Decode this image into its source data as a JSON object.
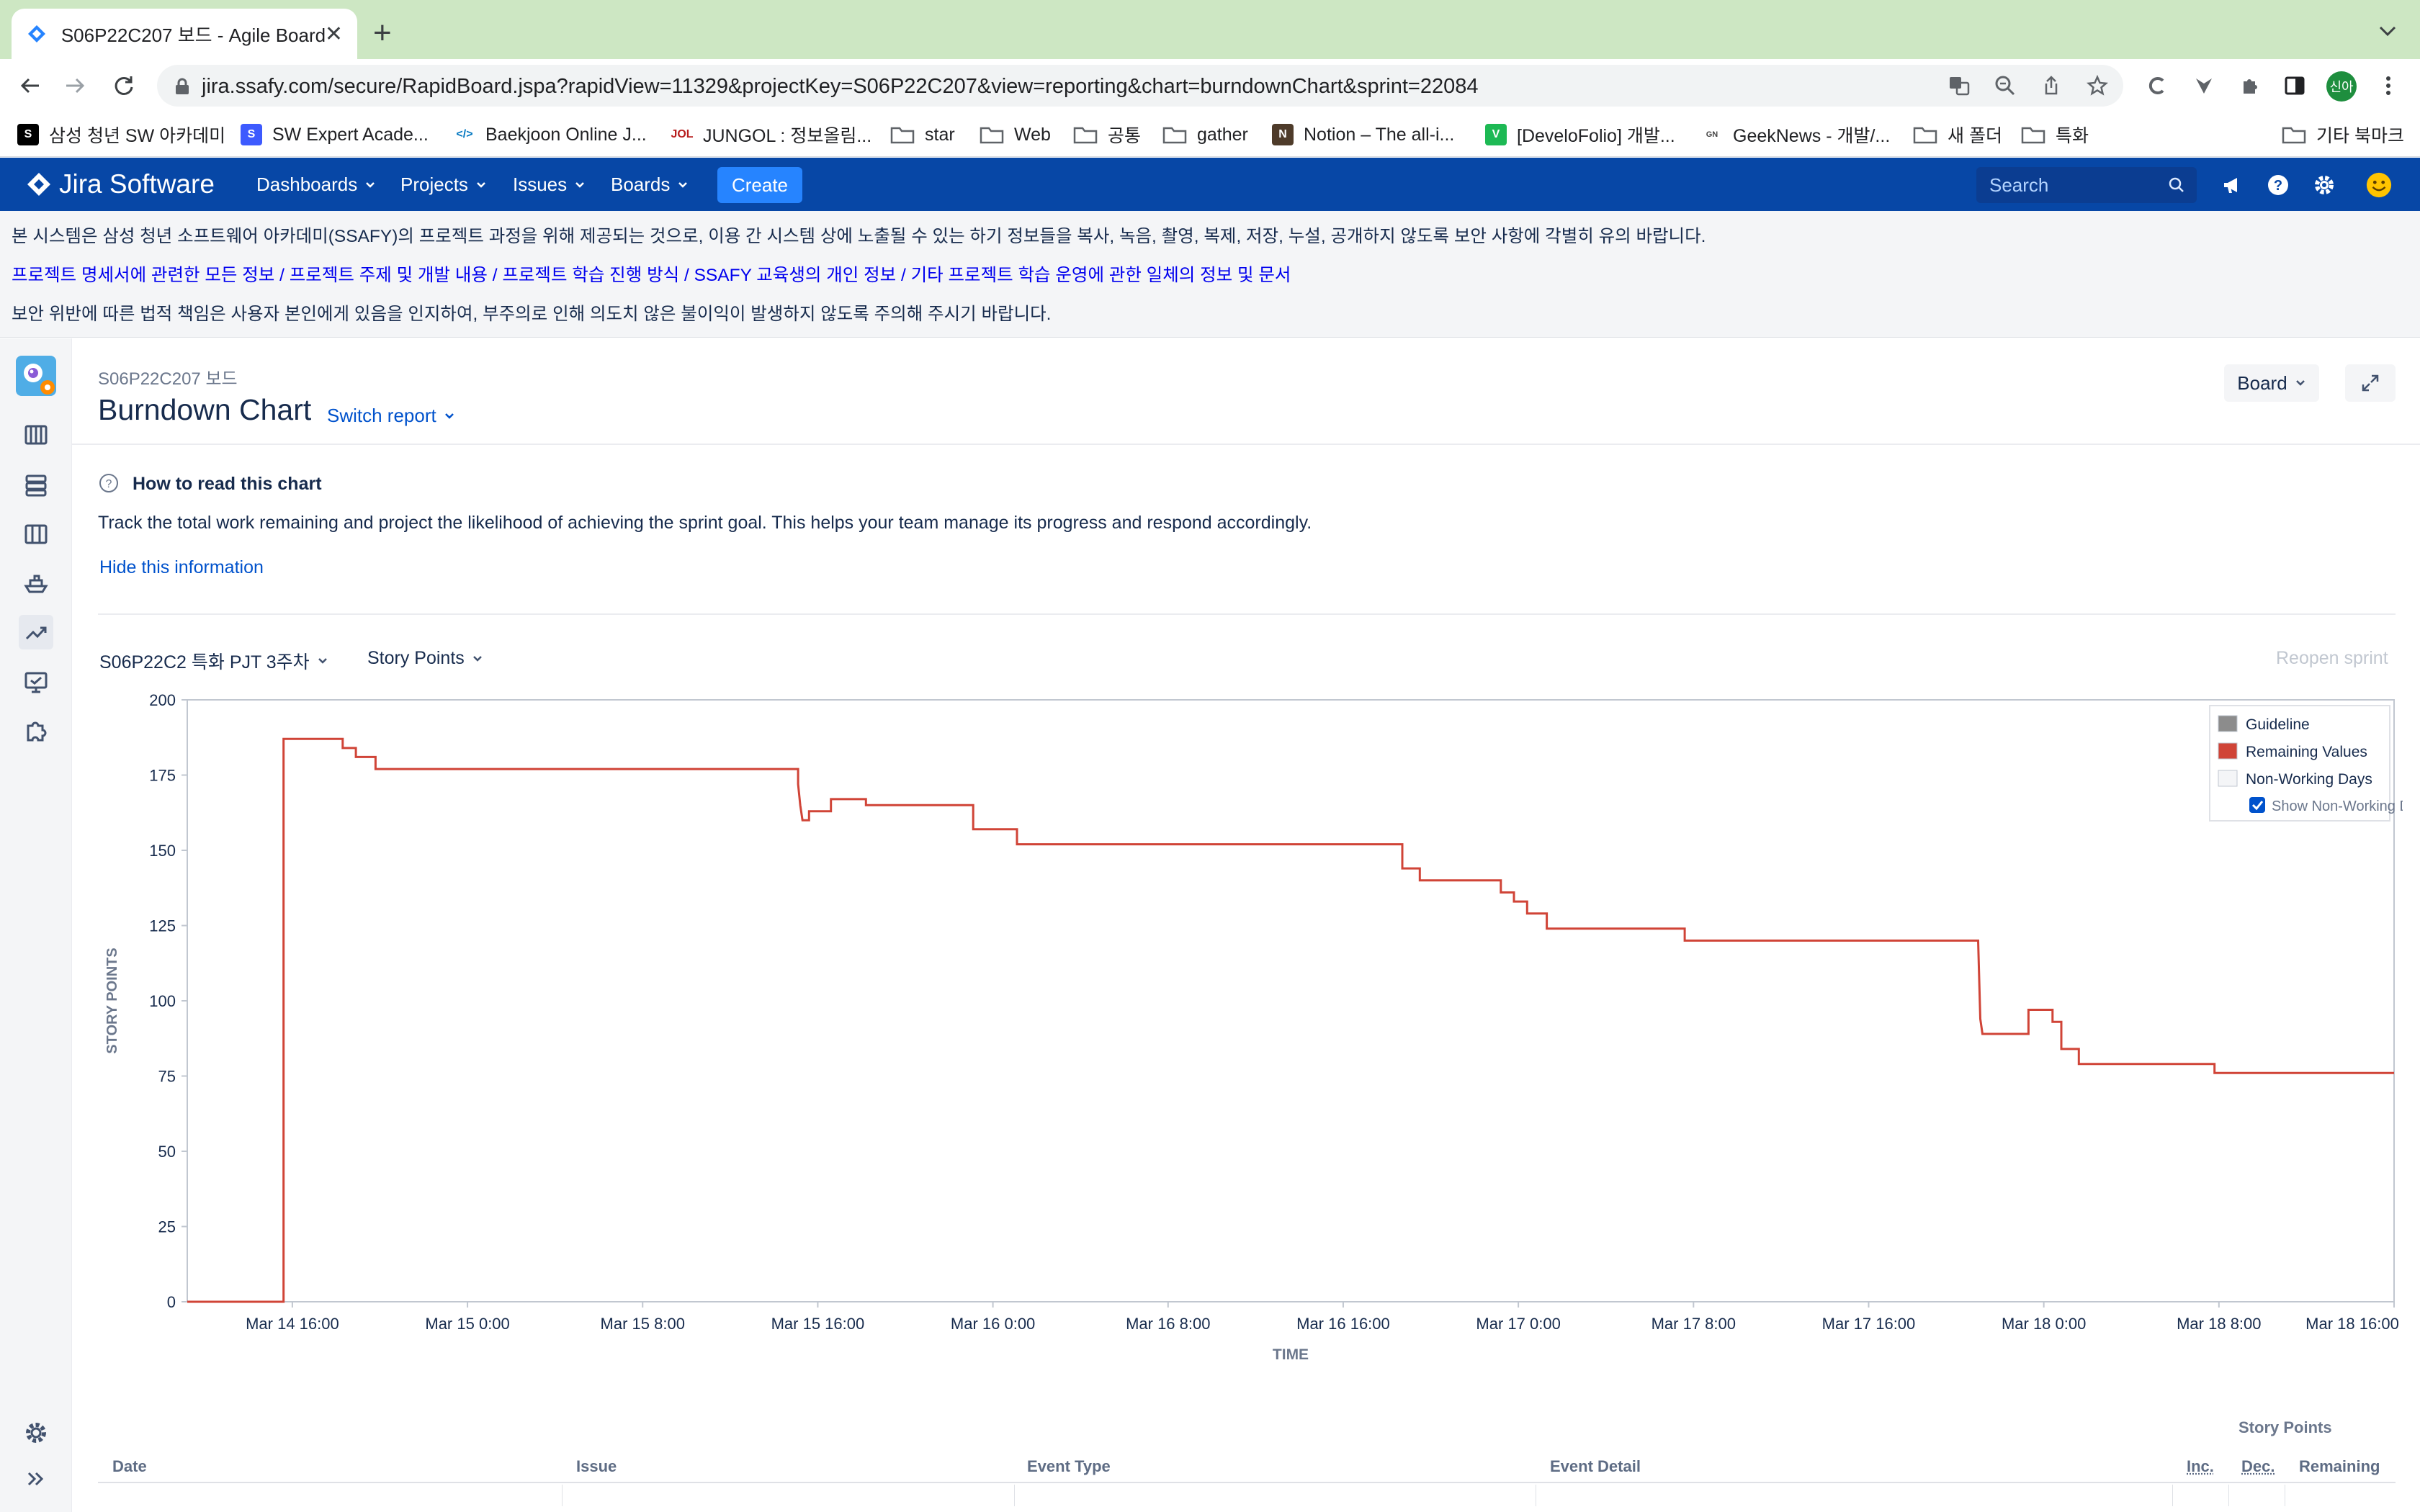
{
  "browser": {
    "tab_title": "S06P22C207 보드 - Agile Board",
    "url": "jira.ssafy.com/secure/RapidBoard.jspa?rapidView=11329&projectKey=S06P22C207&view=reporting&chart=burndownChart&sprint=22084",
    "profile_label": "신아",
    "bookmarks": [
      "삼성 청년 SW 아카데미",
      "SW Expert Acade...",
      "Baekjoon Online J...",
      "JUNGOL : 정보올림...",
      "star",
      "Web",
      "공통",
      "gather",
      "Notion – The all-i...",
      "[DeveloFolio] 개발...",
      "GeekNews - 개발/...",
      "새 폴더",
      "특화",
      "기타 북마크"
    ]
  },
  "jira_header": {
    "logo": "Jira Software",
    "nav": [
      "Dashboards",
      "Projects",
      "Issues",
      "Boards"
    ],
    "create": "Create",
    "search_placeholder": "Search"
  },
  "notice": {
    "line1": "본 시스템은 삼성 청년 소프트웨어 아카데미(SSAFY)의 프로젝트 과정을 위해 제공되는 것으로, 이용 간 시스템 상에 노출될 수 있는 하기 정보들을 복사, 녹음, 촬영, 복제, 저장, 누설, 공개하지 않도록 보안 사항에 각별히 유의 바랍니다.",
    "line2": "프로젝트 명세서에 관련한 모든 정보 / 프로젝트 주제 및 개발 내용 / 프로젝트 학습 진행 방식 / SSAFY 교육생의 개인 정보 / 기타 프로젝트 학습 운영에 관한 일체의 정보 및 문서",
    "line3": "보안 위반에 따른 법적 책임은 사용자 본인에게 있음을 인지하여, 부주의로 인해 의도치 않은 불이익이 발생하지 않도록 주의해 주시기 바랍니다."
  },
  "page": {
    "breadcrumb": "S06P22C207 보드",
    "title": "Burndown Chart",
    "switch_report": "Switch report",
    "board_button": "Board",
    "help_title": "How to read this chart",
    "help_description": "Track the total work remaining and project the likelihood of achieving the sprint goal. This helps your team manage its progress and respond accordingly.",
    "hide_info": "Hide this information",
    "sprint": "S06P22C2 특화 PJT 3주차",
    "metric": "Story Points",
    "reopen": "Reopen sprint"
  },
  "chart_data": {
    "type": "line",
    "xlabel": "TIME",
    "ylabel": "STORY POINTS",
    "ylim": [
      0,
      200
    ],
    "y_ticks": [
      0,
      25,
      50,
      75,
      100,
      125,
      150,
      175,
      200
    ],
    "x_tick_labels": [
      "Mar 14 16:00",
      "Mar 15 0:00",
      "Mar 15 8:00",
      "Mar 15 16:00",
      "Mar 16 0:00",
      "Mar 16 8:00",
      "Mar 16 16:00",
      "Mar 17 0:00",
      "Mar 17 8:00",
      "Mar 17 16:00",
      "Mar 18 0:00",
      "Mar 18 8:00",
      "Mar 18 16:00"
    ],
    "x_unit": "hours from Mar 14 0:00",
    "x_range": [
      11.2,
      112
    ],
    "x_tick_hours": [
      16,
      24,
      32,
      40,
      48,
      56,
      64,
      72,
      80,
      88,
      96,
      104,
      112
    ],
    "legend": {
      "position": "top-right",
      "items": [
        {
          "name": "Guideline",
          "color": "#8c8c8c"
        },
        {
          "name": "Remaining Values",
          "color": "#d04437"
        },
        {
          "name": "Non-Working Days",
          "color": "#f4f5f7"
        }
      ],
      "checkbox_label": "Show Non-Working Days",
      "checkbox_checked": true
    },
    "series": [
      {
        "name": "Remaining Values",
        "color": "#d04437",
        "step": true,
        "points": [
          [
            11.2,
            0
          ],
          [
            15.6,
            0
          ],
          [
            15.6,
            187
          ],
          [
            18.3,
            187
          ],
          [
            18.3,
            184
          ],
          [
            18.9,
            184
          ],
          [
            18.9,
            181
          ],
          [
            19.8,
            181
          ],
          [
            19.8,
            177
          ],
          [
            39.1,
            177
          ],
          [
            39.1,
            172
          ],
          [
            39.2,
            165
          ],
          [
            39.3,
            160
          ],
          [
            39.6,
            160
          ],
          [
            39.6,
            163
          ],
          [
            40.6,
            163
          ],
          [
            40.6,
            167
          ],
          [
            42.2,
            167
          ],
          [
            42.2,
            165
          ],
          [
            47.1,
            165
          ],
          [
            47.1,
            157
          ],
          [
            49.1,
            157
          ],
          [
            49.1,
            152
          ],
          [
            66.7,
            152
          ],
          [
            66.7,
            144
          ],
          [
            67.5,
            144
          ],
          [
            67.5,
            140
          ],
          [
            71.2,
            140
          ],
          [
            71.2,
            136
          ],
          [
            71.8,
            136
          ],
          [
            71.8,
            133
          ],
          [
            72.4,
            133
          ],
          [
            72.4,
            129
          ],
          [
            73.3,
            129
          ],
          [
            73.3,
            124
          ],
          [
            79.6,
            124
          ],
          [
            79.6,
            120
          ],
          [
            93.0,
            120
          ],
          [
            93.1,
            94
          ],
          [
            93.2,
            89
          ],
          [
            95.3,
            89
          ],
          [
            95.3,
            97
          ],
          [
            96.4,
            97
          ],
          [
            96.4,
            93
          ],
          [
            96.8,
            93
          ],
          [
            96.8,
            84
          ],
          [
            97.6,
            84
          ],
          [
            97.6,
            79
          ],
          [
            103.8,
            79
          ],
          [
            103.8,
            76
          ],
          [
            118.5,
            76
          ]
        ]
      }
    ]
  },
  "table": {
    "group_header": "Story Points",
    "columns": [
      "Date",
      "Issue",
      "Event Type",
      "Event Detail",
      "Inc.",
      "Dec.",
      "Remaining"
    ]
  }
}
